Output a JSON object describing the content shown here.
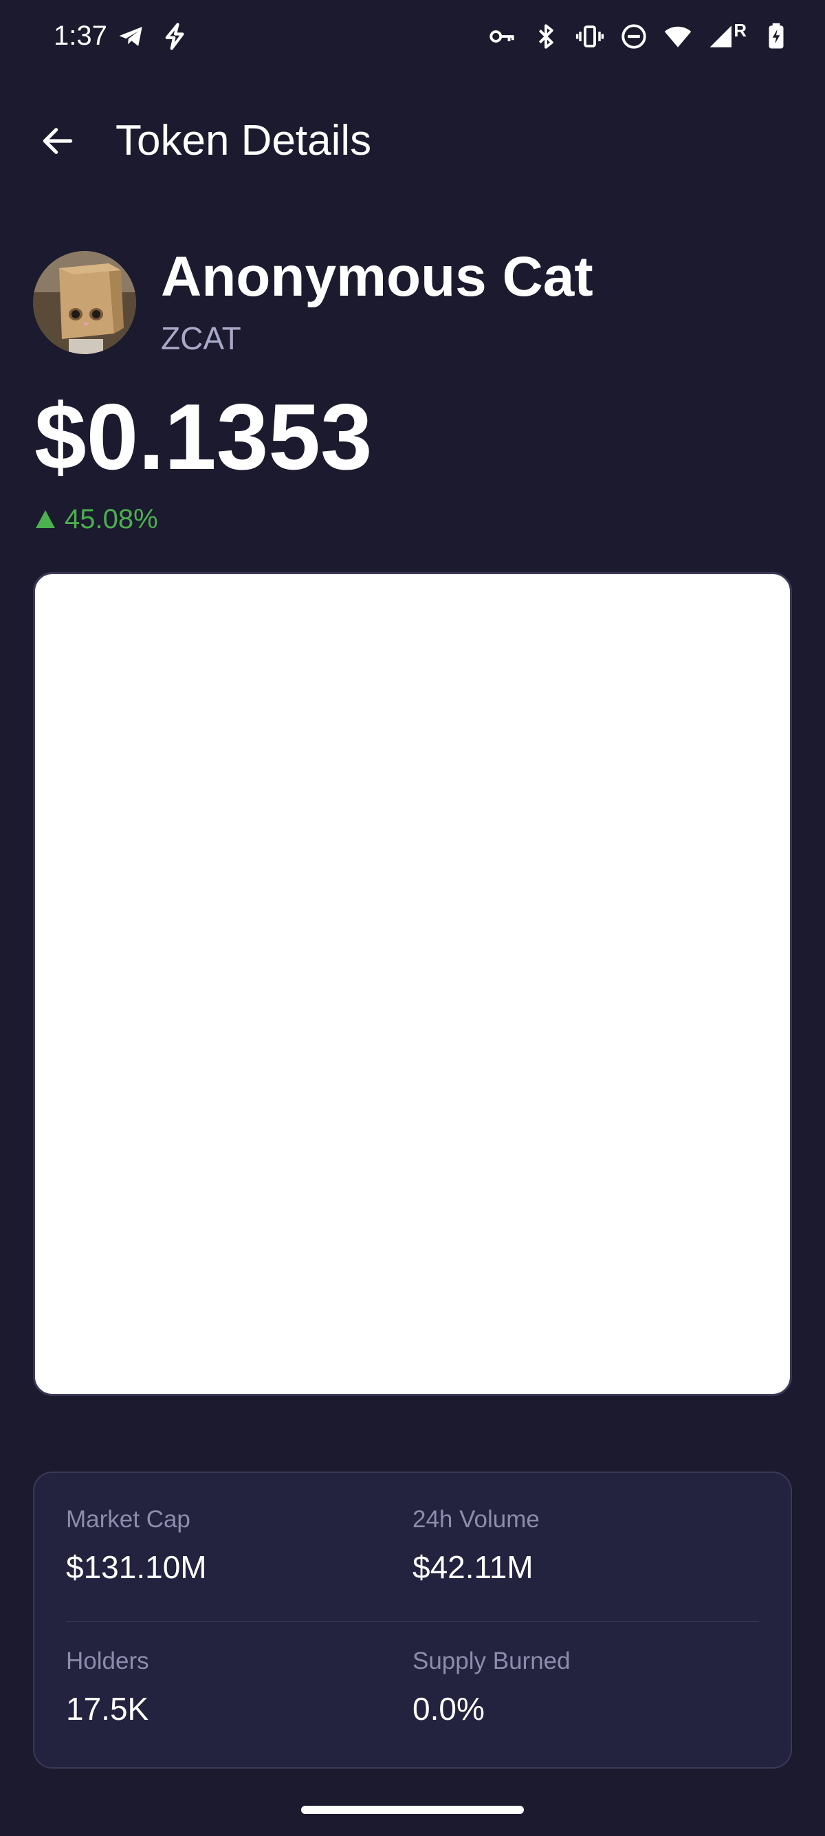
{
  "status_bar": {
    "time": "1:37",
    "left_icons": [
      "telegram-icon",
      "lightning-icon"
    ],
    "right_icons": [
      "key-icon",
      "bluetooth-icon",
      "vibrate-icon",
      "do-not-disturb-icon",
      "wifi-icon",
      "signal-icon",
      "battery-charging-icon"
    ],
    "roaming_indicator": "R"
  },
  "header": {
    "title": "Token Details",
    "back_icon": "arrow-left-icon"
  },
  "token": {
    "name": "Anonymous Cat",
    "symbol": "ZCAT",
    "price": "$0.1353",
    "change": "45.08%",
    "change_direction": "up",
    "change_color": "#4caf50"
  },
  "stats": {
    "market_cap_label": "Market Cap",
    "market_cap_value": "$131.10M",
    "volume_label": "24h Volume",
    "volume_value": "$42.11M",
    "holders_label": "Holders",
    "holders_value": "17.5K",
    "supply_burned_label": "Supply Burned",
    "supply_burned_value": "0.0%"
  },
  "colors": {
    "background": "#1b1a2e",
    "card": "#23223f",
    "positive": "#4caf50"
  }
}
